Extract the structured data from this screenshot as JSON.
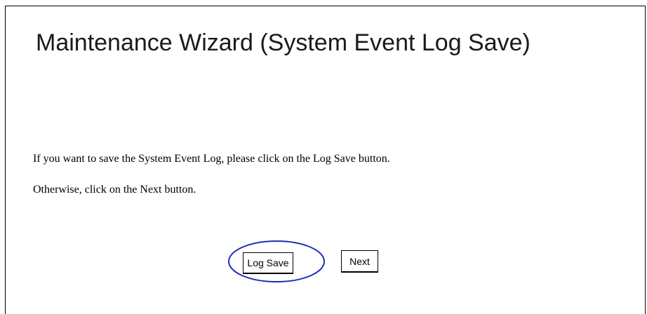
{
  "page": {
    "title": "Maintenance Wizard (System Event Log Save)",
    "instructions": [
      "If you want to save the System Event Log, please click on the Log Save button.",
      "Otherwise, click on the Next button."
    ]
  },
  "buttons": {
    "log_save_label": "Log Save",
    "next_label": "Next"
  },
  "highlight": {
    "target": "log-save-button",
    "color": "#1f2eb8"
  }
}
